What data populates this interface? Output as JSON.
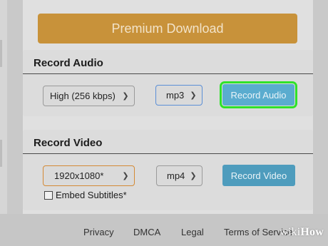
{
  "premium": {
    "label": "Premium Download"
  },
  "record_audio": {
    "title": "Record Audio",
    "quality": "High (256 kbps)",
    "format": "mp3",
    "button": "Record Audio"
  },
  "record_video": {
    "title": "Record Video",
    "resolution": "1920x1080*",
    "format": "mp4",
    "button": "Record Video",
    "embed_subtitles": {
      "label": "Embed Subtitles*",
      "checked": false
    }
  },
  "footer": {
    "links": [
      "Privacy",
      "DMCA",
      "Legal",
      "Terms of Service"
    ]
  },
  "watermark": {
    "wiki": "wiki",
    "how": "How"
  },
  "colors": {
    "premium": "#c8923a",
    "action_button": "#5aaccf",
    "highlight": "#2fe22a",
    "select_focus_blue": "#5b8fd6",
    "select_focus_orange": "#d48a35"
  },
  "icons": {
    "select_arrow": "chevron-down-icon"
  }
}
